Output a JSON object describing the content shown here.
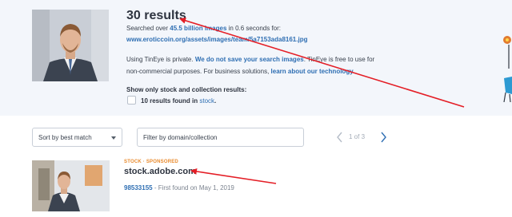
{
  "summary": {
    "results_title": "30 results",
    "searched_prefix": "Searched over ",
    "searched_count": "45.5 billion images",
    "searched_suffix": " in 0.6 seconds for:",
    "query_url": "www.eroticcoin.org/assets/images/team/5a7153ada8161.jpg"
  },
  "privacy": {
    "line1_prefix": "Using TinEye is private. ",
    "line1_link": "We do not save your search images",
    "line1_suffix": ". TinEye is free to use for",
    "line2_prefix": "non-commercial purposes. For business solutions, ",
    "line2_link": "learn about our technology",
    "line2_suffix": "."
  },
  "stock_filter": {
    "heading": "Show only stock and collection results:",
    "count_prefix": "10 results found in ",
    "count_link": "stock",
    "count_suffix": "."
  },
  "controls": {
    "sort_label": "Sort by best match",
    "filter_placeholder": "Filter by domain/collection",
    "pager_text": "1   of   3"
  },
  "result": {
    "badge": "STOCK · SPONSORED",
    "domain": "stock.adobe.com",
    "id_link": "98533155",
    "first_found": " - First found on May 1, 2019"
  },
  "colors": {
    "accent_link": "#2f6fb3",
    "annotation_arrow": "#e41e26",
    "stock_badge": "#e98a2c",
    "panel_background": "#f3f6fb"
  },
  "icons": [
    "chevron-down-icon",
    "chevron-left-icon",
    "chevron-right-icon",
    "checkbox-icon"
  ]
}
